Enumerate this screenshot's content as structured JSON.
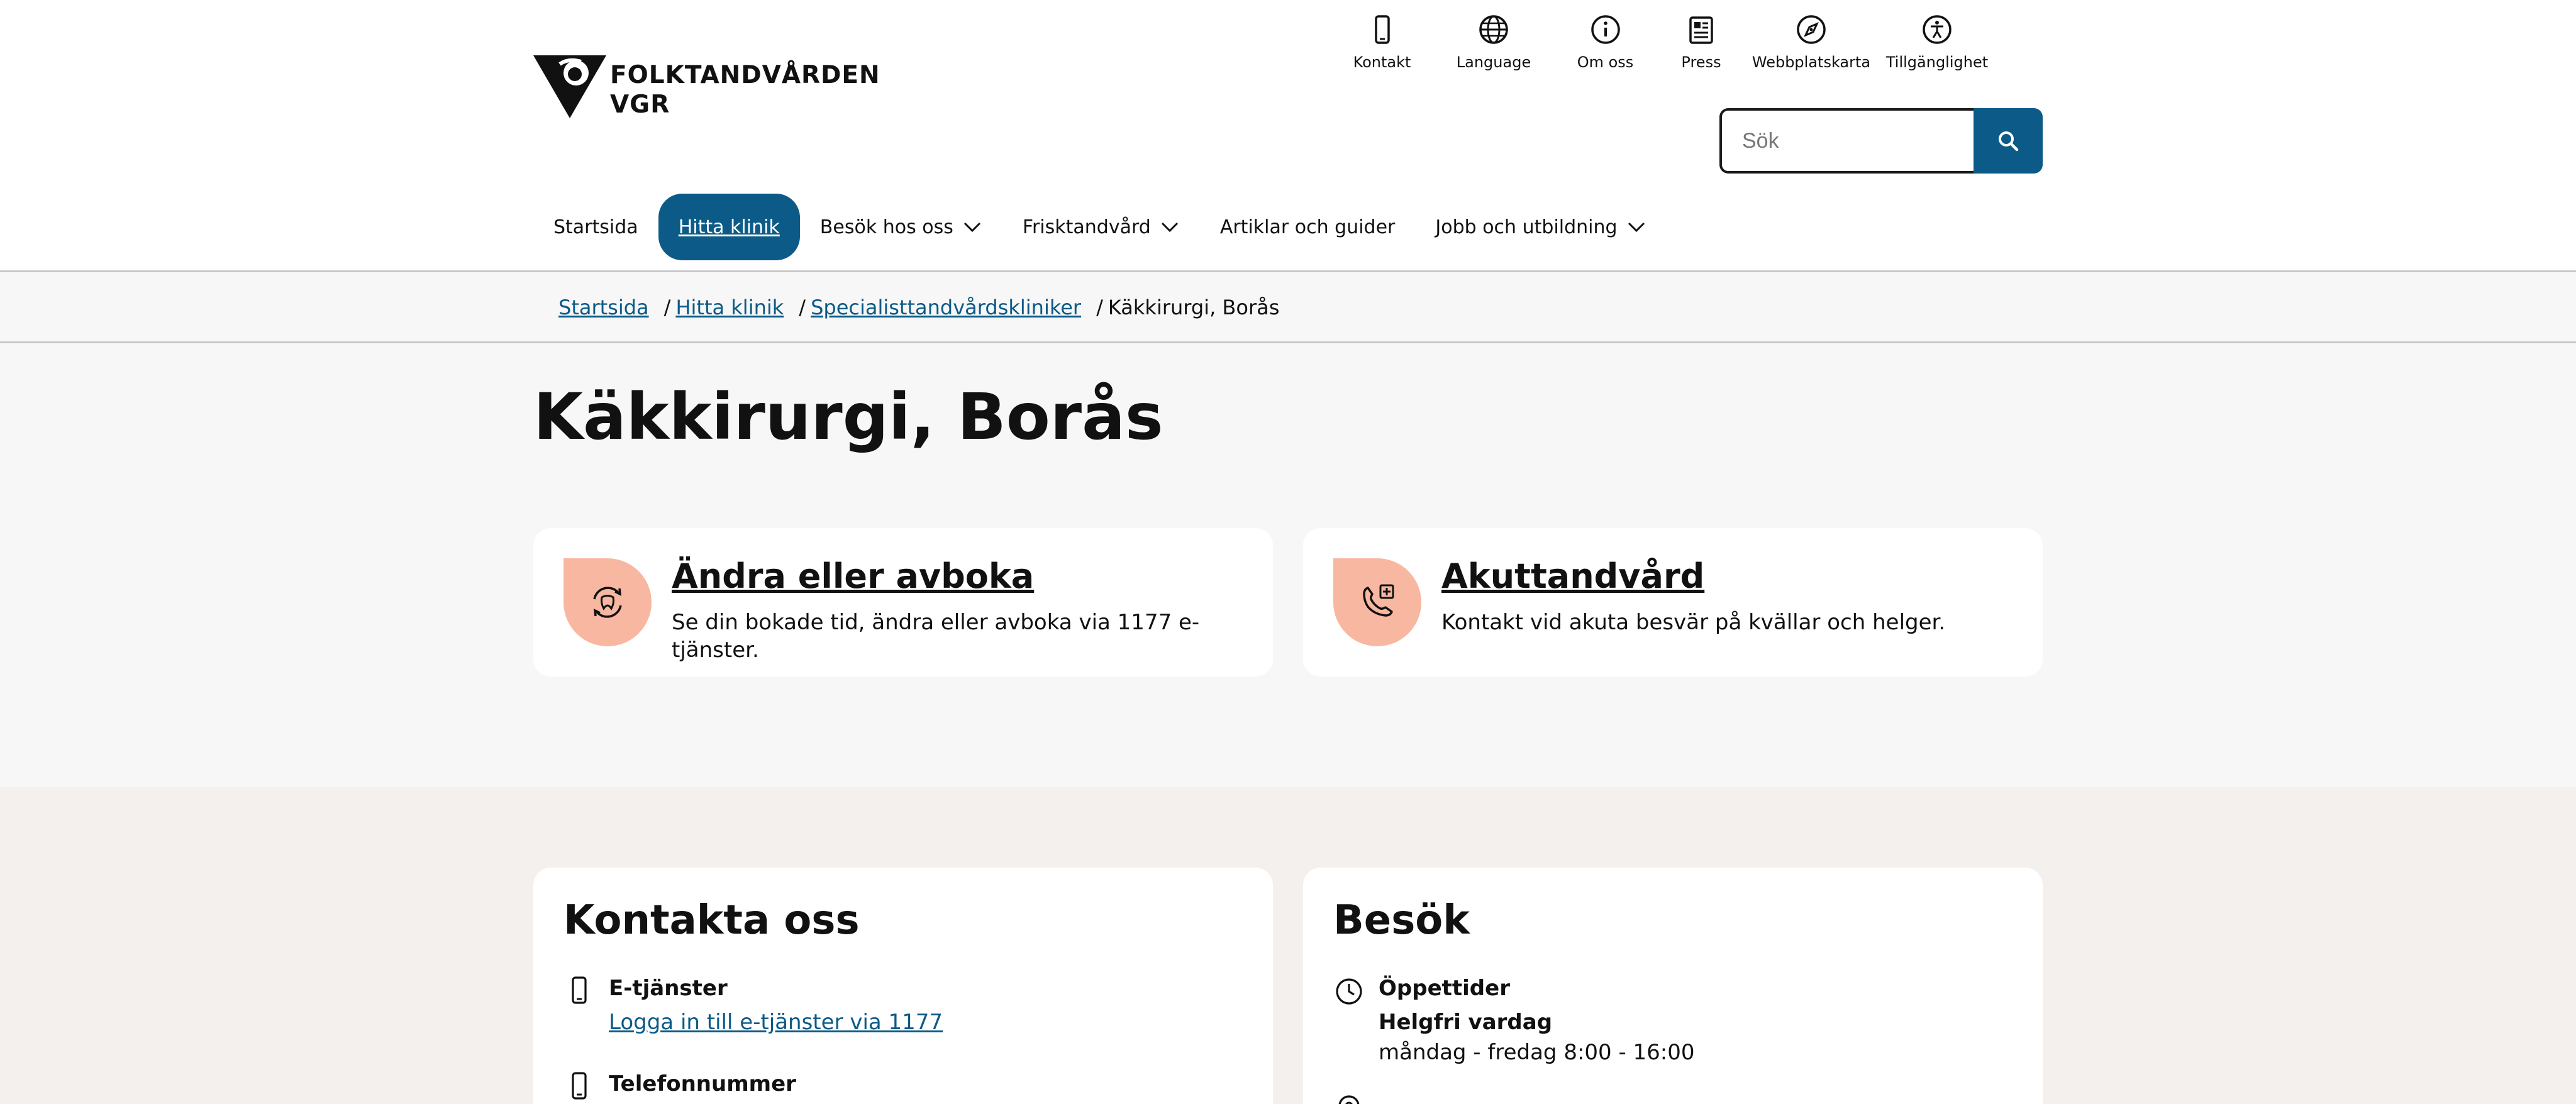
{
  "header": {
    "logo": {
      "line1": "FOLKTANDVÅRDEN",
      "line2": "VGR"
    },
    "utility_nav": [
      {
        "label": "Kontakt",
        "icon": "phone-icon"
      },
      {
        "label": "Language",
        "icon": "globe-icon"
      },
      {
        "label": "Om oss",
        "icon": "info-icon"
      },
      {
        "label": "Press",
        "icon": "newspaper-icon"
      },
      {
        "label": "Webbplatskarta",
        "icon": "compass-icon"
      },
      {
        "label": "Tillgänglighet",
        "icon": "accessibility-icon"
      }
    ],
    "search": {
      "placeholder": "Sök",
      "value": ""
    },
    "main_nav": [
      {
        "label": "Startsida",
        "has_dropdown": false,
        "active": false
      },
      {
        "label": "Hitta klinik",
        "has_dropdown": false,
        "active": true
      },
      {
        "label": "Besök hos oss",
        "has_dropdown": true,
        "active": false
      },
      {
        "label": "Frisktandvård",
        "has_dropdown": true,
        "active": false
      },
      {
        "label": "Artiklar och guider",
        "has_dropdown": false,
        "active": false
      },
      {
        "label": "Jobb och utbildning",
        "has_dropdown": true,
        "active": false
      }
    ]
  },
  "breadcrumb": {
    "links": [
      "Startsida",
      "Hitta klinik",
      "Specialisttandvårdskliniker"
    ],
    "separator": "/",
    "current": "Käkkirurgi, Borås"
  },
  "hero": {
    "title": "Käkkirurgi, Borås",
    "cards": [
      {
        "title": "Ändra eller avboka",
        "description": "Se din bokade tid, ändra eller avboka via 1177 e-tjänster.",
        "icon": "tooth-refresh-icon"
      },
      {
        "title": "Akuttandvård",
        "description": "Kontakt vid akuta besvär på kvällar och helger.",
        "icon": "phone-plus-icon"
      }
    ]
  },
  "contact": {
    "title": "Kontakta oss",
    "e_services_label": "E-tjänster",
    "e_services_link": "Logga in till e-tjänster via 1177",
    "phone_label": "Telefonnummer"
  },
  "visit": {
    "title": "Besök",
    "hours_label": "Öppettider",
    "day_type": "Helgfri vardag",
    "hours": "måndag - fredag 8:00 - 16:00"
  },
  "colors": {
    "brand_blue": "#0b5a87",
    "icon_bg": "#f8b7a1",
    "hero_bg": "#f7f7f7",
    "info_bg": "#f4f0ee"
  }
}
